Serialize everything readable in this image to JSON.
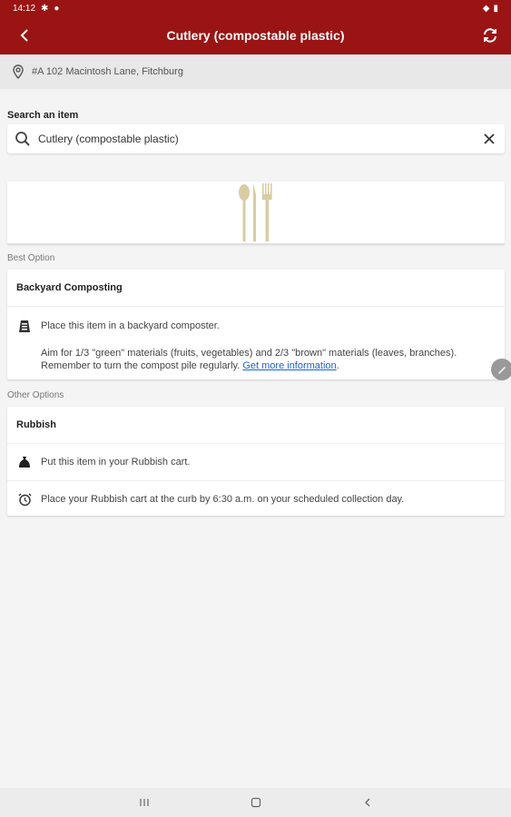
{
  "status_bar": {
    "time": "14:12"
  },
  "app_bar": {
    "title": "Cutlery (compostable plastic)"
  },
  "address": {
    "text": "#A 102 Macintosh Lane, Fitchburg"
  },
  "search": {
    "label": "Search an item",
    "value": "Cutlery (compostable plastic)"
  },
  "best_option": {
    "section_label": "Best Option",
    "title": "Backyard Composting",
    "instruction": "Place this item in a backyard composter.",
    "detail": "Aim for 1/3 \"green\" materials (fruits, vegetables) and 2/3 \"brown\" materials (leaves, branches). Remember to turn the compost pile regularly.",
    "link": "Get more information"
  },
  "other_options": {
    "section_label": "Other Options",
    "title": "Rubbish",
    "rows": [
      "Put this item in your Rubbish cart.",
      "Place your Rubbish cart at the curb by 6:30 a.m. on your scheduled collection day."
    ]
  },
  "colors": {
    "brand": "#9b1414",
    "link": "#1a63d8"
  }
}
